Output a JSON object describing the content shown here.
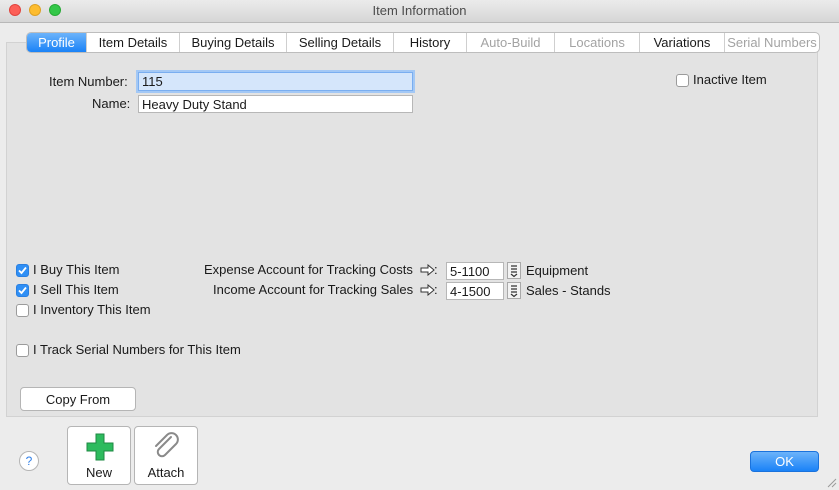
{
  "window": {
    "title": "Item Information"
  },
  "tabs": [
    {
      "label": "Profile",
      "state": "active"
    },
    {
      "label": "Item Details",
      "state": "normal"
    },
    {
      "label": "Buying Details",
      "state": "normal"
    },
    {
      "label": "Selling Details",
      "state": "normal"
    },
    {
      "label": "History",
      "state": "normal"
    },
    {
      "label": "Auto-Build",
      "state": "disabled"
    },
    {
      "label": "Locations",
      "state": "disabled"
    },
    {
      "label": "Variations",
      "state": "normal"
    },
    {
      "label": "Serial Numbers",
      "state": "disabled"
    }
  ],
  "profile": {
    "item_number_label": "Item Number:",
    "item_number_value": "115",
    "name_label": "Name:",
    "name_value": "Heavy Duty Stand",
    "inactive_label": "Inactive Item",
    "inactive_checked": false
  },
  "options": {
    "buy_label": "I Buy This Item",
    "buy_checked": true,
    "sell_label": "I Sell This Item",
    "sell_checked": true,
    "inventory_label": "I Inventory This Item",
    "inventory_checked": false,
    "serial_label": "I Track Serial Numbers for This Item",
    "serial_checked": false
  },
  "accounts": {
    "expense_label": "Expense Account for Tracking Costs",
    "expense_account": "5-1100",
    "expense_name": "Equipment",
    "income_label": "Income Account for Tracking Sales",
    "income_account": "4-1500",
    "income_name": "Sales - Stands",
    "colon": ":"
  },
  "buttons": {
    "copy_from": "Copy From",
    "new": "New",
    "attach": "Attach",
    "help": "?",
    "ok": "OK"
  },
  "colors": {
    "accent": "#1a82f7",
    "checkbox": "#2f8ff5",
    "new_icon": "#2dbb5e"
  },
  "icons": {
    "new": "plus-icon",
    "attach": "paperclip-icon",
    "account_arrow": "arrow-right-icon"
  }
}
